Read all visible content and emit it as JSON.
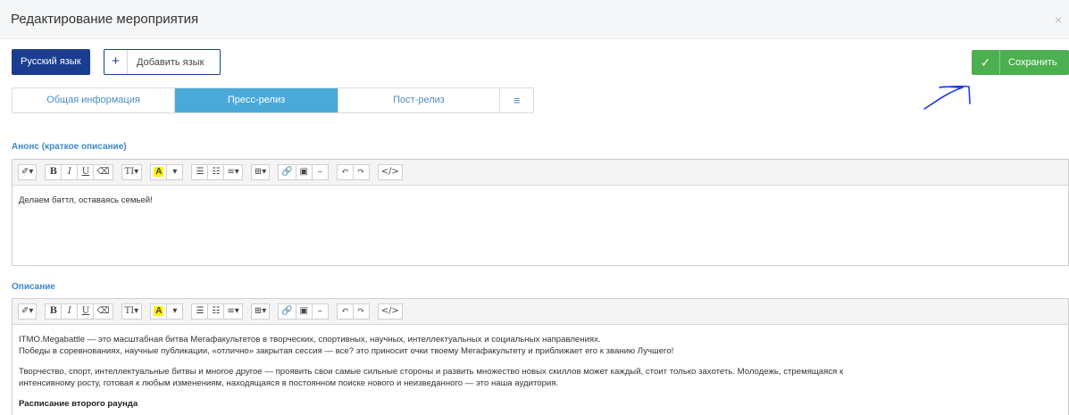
{
  "header": {
    "title": "Редактирование мероприятия",
    "close_label": "×"
  },
  "languages": {
    "current": "Русский язык",
    "add_icon": "+",
    "add_label": "Добавить язык"
  },
  "save": {
    "icon": "✓",
    "label": "Сохранить",
    "color": "#4caf50"
  },
  "tabs": [
    {
      "label": "Общая информация",
      "active": false
    },
    {
      "label": "Пресс-релиз",
      "active": true
    },
    {
      "label": "Пост-релиз",
      "active": false
    },
    {
      "label": "≡",
      "active": false
    }
  ],
  "toolbar": {
    "style": "✐▾",
    "bold": "B",
    "italic": "I",
    "underline": "U",
    "eraser": "⌫",
    "font_size": "TI▾",
    "highlight": "A",
    "highlight_dd": "▾",
    "ul": "☰",
    "ol": "☷",
    "align": "≡▾",
    "table": "⊞▾",
    "link": "🔗",
    "image": "▣",
    "hr": "–",
    "undo": "↶",
    "redo": "↷",
    "code": "</>"
  },
  "anons": {
    "label": "Анонс (краткое описание)",
    "text": "Делаем баттл, оставаясь семьей!"
  },
  "description": {
    "label": "Описание",
    "p1_line1": "ITMO.Megabattle — это масштабная битва Мегафакультетов в творческих, спортивных, научных, интеллектуальных и социальных направлениях.",
    "p1_line2": "Победы в соревнованиях, научные публикации, «отлично» закрытая сессия — все? это приносит очки твоему Мегафакультету и приближает его к званию Лучшего!",
    "p2_line1": "Творчество, спорт, интеллектуальные битвы и многое другое — проявить свои самые сильные стороны и развить множество новых скиллов может каждый, стоит только захотеть. Молодежь, стремящаяся к",
    "p2_line2": "интенсивному росту, готовая к любым изменениям, находящаяся в постоянном поиске нового и неизведанного — это наша аудитория.",
    "p3_bold": "Расписание второго раунда"
  }
}
